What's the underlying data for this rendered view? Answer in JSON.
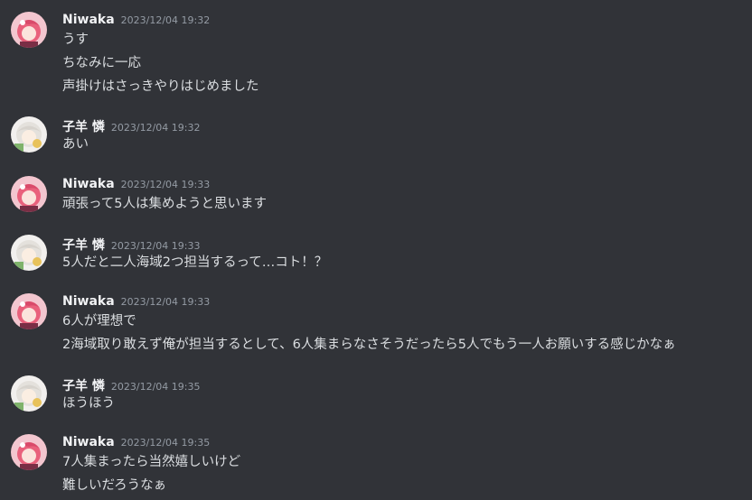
{
  "messages": [
    {
      "username": "Niwaka",
      "timestamp": "2023/12/04 19:32",
      "avatar": "niwaka",
      "lines": [
        "うす",
        "ちなみに一応",
        "声掛けはさっきやりはじめました"
      ]
    },
    {
      "username": "子羊 憐",
      "timestamp": "2023/12/04 19:32",
      "avatar": "kohitsuji",
      "lines": [
        "あい"
      ]
    },
    {
      "username": "Niwaka",
      "timestamp": "2023/12/04 19:33",
      "avatar": "niwaka",
      "lines": [
        "頑張って5人は集めようと思います"
      ]
    },
    {
      "username": "子羊 憐",
      "timestamp": "2023/12/04 19:33",
      "avatar": "kohitsuji",
      "lines": [
        "5人だと二人海域2つ担当するって…コト！？"
      ]
    },
    {
      "username": "Niwaka",
      "timestamp": "2023/12/04 19:33",
      "avatar": "niwaka",
      "lines": [
        "6人が理想で",
        "2海域取り敢えず俺が担当するとして、6人集まらなさそうだったら5人でもう一人お願いする感じかなぁ"
      ]
    },
    {
      "username": "子羊 憐",
      "timestamp": "2023/12/04 19:35",
      "avatar": "kohitsuji",
      "lines": [
        "ほうほう"
      ]
    },
    {
      "username": "Niwaka",
      "timestamp": "2023/12/04 19:35",
      "avatar": "niwaka",
      "lines": [
        "7人集まったら当然嬉しいけど",
        "難しいだろうなぁ"
      ]
    }
  ]
}
